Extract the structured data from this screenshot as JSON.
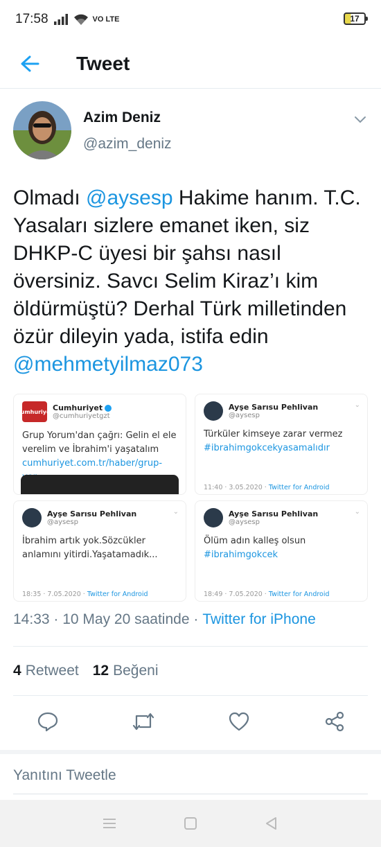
{
  "status_bar": {
    "time": "17:58",
    "network": "VO LTE",
    "battery": "17"
  },
  "header": {
    "title": "Tweet"
  },
  "tweet": {
    "author_name": "Azim Deniz",
    "author_handle": "@azim_deniz",
    "text_parts": {
      "p1": "Olmadı ",
      "mention1": "@aysesp",
      "p2": " Hakime hanım. T.C. Yasaları sizlere emanet iken, siz DHKP-C üyesi bir şahsı nasıl översiniz. Savcı Selim Kiraz’ı kim öldürmüştü?  Derhal Türk milletinden özür dileyin yada, istifa edin ",
      "mention2": "@mehmetyilmaz073"
    },
    "media": [
      {
        "name": "Cumhuriyet",
        "handle": "@cumhuriyetgzt",
        "logo": "Cumhuriyet",
        "text": "Grup Yorum'dan çağrı: Gelin el ele verelim ve İbrahim'i yaşatalım",
        "link": "cumhuriyet.com.tr/haber/grup-yor..."
      },
      {
        "name": "Ayşe Sarısu Pehlivan",
        "handle": "@aysesp",
        "text": "Türküler kimseye zarar vermez ",
        "hashtag": "#ibrahimgokcekyasamalıdır",
        "time": "11:40 · 3.05.2020 · ",
        "via": "Twitter for Android"
      },
      {
        "name": "Ayşe Sarısu Pehlivan",
        "handle": "@aysesp",
        "text": "İbrahim artık yok.Sözcükler anlamını yitirdi.Yaşatamadık...",
        "time": "18:35 · 7.05.2020 · ",
        "via": "Twitter for Android"
      },
      {
        "name": "Ayşe Sarısu Pehlivan",
        "handle": "@aysesp",
        "text": "Ölüm  adın kalleş olsun ",
        "hashtag": "#ibrahimgokcek",
        "time": "18:49 · 7.05.2020 · ",
        "via": "Twitter for Android"
      }
    ],
    "timestamp": "14:33 · 10 May 20 saatinde ·",
    "via": "Twitter for iPhone",
    "retweet_count": "4",
    "retweet_label": "Retweet",
    "like_count": "12",
    "like_label": "Beğeni"
  },
  "reply": {
    "placeholder": "Yanıtını Tweetle"
  },
  "icons": {
    "back": "arrow-left-icon",
    "caret": "chevron-down-icon",
    "reply": "reply-icon",
    "retweet": "retweet-icon",
    "like": "heart-icon",
    "share": "share-icon"
  },
  "colors": {
    "accent": "#1DA1F2",
    "link": "#1B95E0",
    "secondary_text": "#657786"
  }
}
